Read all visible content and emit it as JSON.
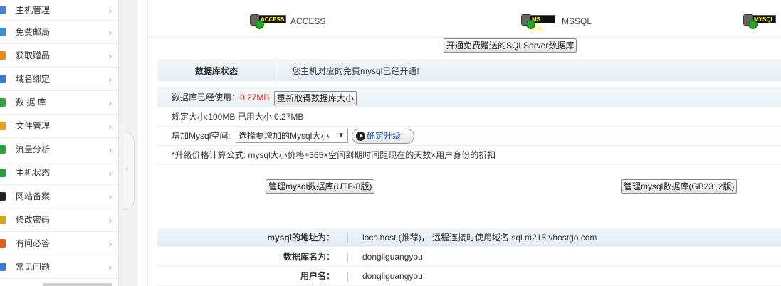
{
  "sidebar": {
    "items": [
      {
        "label": "主机管理",
        "icon": "host-icon",
        "color": "#4a7fc9"
      },
      {
        "label": "免费邮局",
        "icon": "mail-icon",
        "color": "#3b8fd6"
      },
      {
        "label": "获取赠品",
        "icon": "gift-icon",
        "color": "#e88a1a"
      },
      {
        "label": "域名绑定",
        "icon": "domain-icon",
        "color": "#3a7bd5"
      },
      {
        "label": "数 据 库",
        "icon": "database-icon",
        "color": "#37a043"
      },
      {
        "label": "文件管理",
        "icon": "folder-icon",
        "color": "#e8a21f"
      },
      {
        "label": "流量分析",
        "icon": "traffic-icon",
        "color": "#2f9e3e"
      },
      {
        "label": "主机状态",
        "icon": "status-icon",
        "color": "#2a9c39"
      },
      {
        "label": "网站备案",
        "icon": "record-icon",
        "color": "#222222"
      },
      {
        "label": "修改密码",
        "icon": "key-icon",
        "color": "#d9a21c"
      },
      {
        "label": "有问必答",
        "icon": "question-icon",
        "color": "#d9661c"
      },
      {
        "label": "常见问题",
        "icon": "faq-icon",
        "color": "#3a7bd5"
      }
    ]
  },
  "db_types": [
    {
      "tag": "ACCESS",
      "label": "ACCESS"
    },
    {
      "tag": "MS SQL",
      "label": "MSSQL"
    },
    {
      "tag": "MYSQL",
      "label": ""
    }
  ],
  "mssql_button": "开通免费赠送的SQLServer数据库",
  "status": {
    "label": "数据库状态",
    "value": "您主机对应的免费mysql已经开通!"
  },
  "usage": {
    "used_label": "数据库已经使用：",
    "used_value": "0.27MB",
    "refresh_button": "重新取得数据库大小",
    "size_line": "规定大小:100MB 已用大小:0.27MB",
    "add_label": "增加Mysql空间:",
    "select_value": "选择要增加的Mysql大小",
    "upgrade_button": "确定升级",
    "formula": "*升级价格计算公式: mysql大小价格÷365×空间到期时间距现在的天数×用户身份的折扣"
  },
  "manage": {
    "utf8_button": "管理mysql数据库(UTF-8版)",
    "gb_button": "管理mysql数据库(GB2312版)"
  },
  "info": {
    "rows": [
      {
        "key": "mysql的地址为：",
        "value": "localhost (推荐)， 远程连接时使用域名:sql.m215.vhostgo.com"
      },
      {
        "key": "数据库名为：",
        "value": "dongliguangyou"
      },
      {
        "key": "用户名：",
        "value": "dongliguangyou"
      }
    ]
  },
  "colors": {
    "accent_red": "#e0201b",
    "link_blue": "#1a53a8"
  }
}
